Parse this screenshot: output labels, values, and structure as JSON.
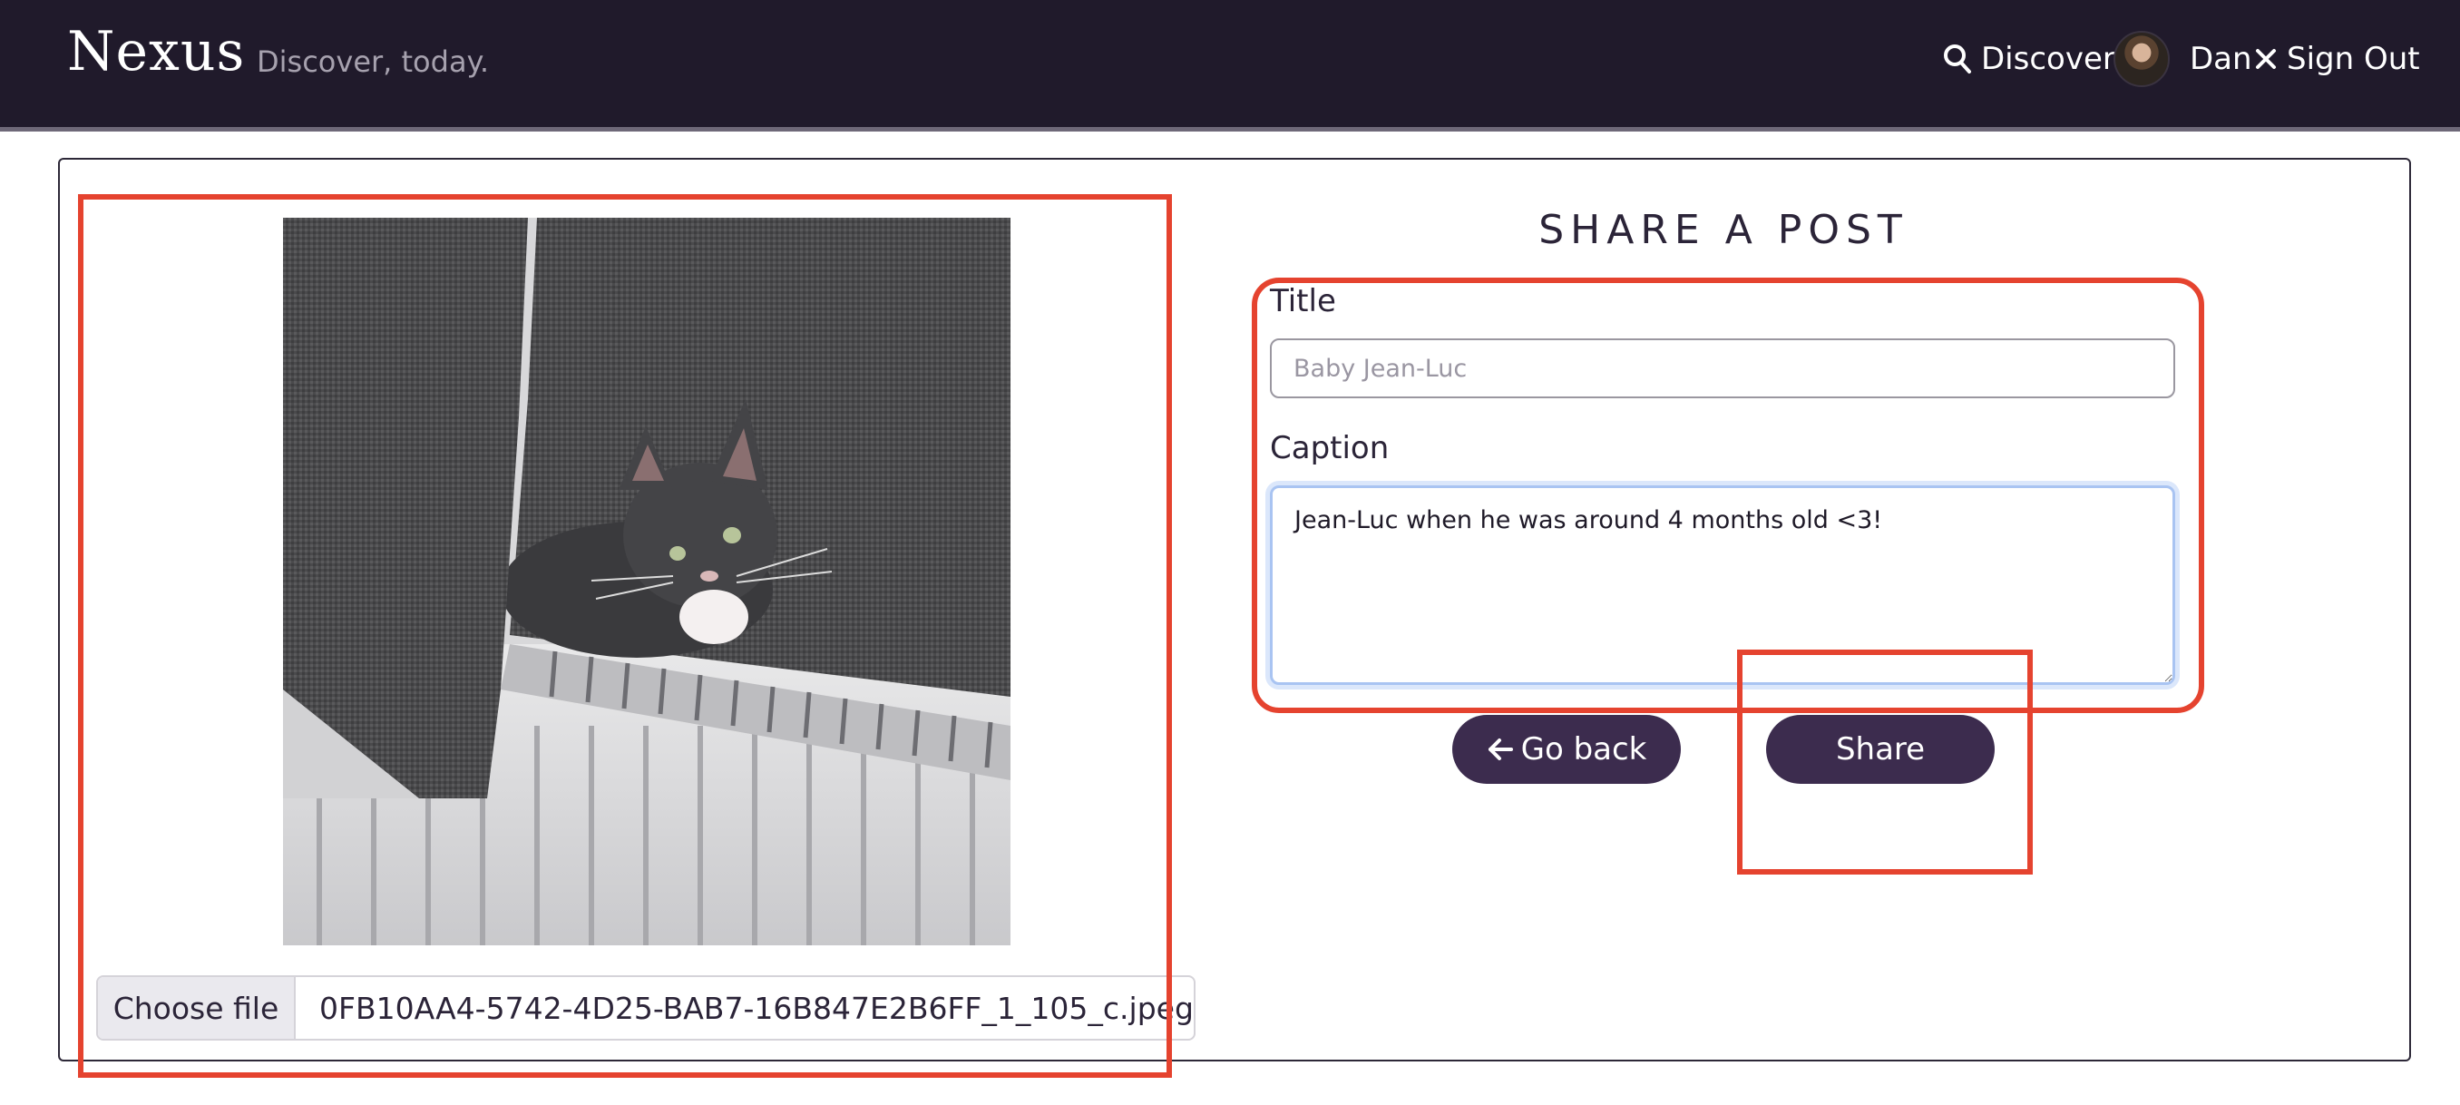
{
  "header": {
    "brand": "Nexus",
    "tagline": "Discover, today.",
    "nav": {
      "discover": "Discover",
      "user_name": "Dan",
      "sign_out": "Sign Out"
    }
  },
  "upload": {
    "choose_file_label": "Choose file",
    "file_name": "0FB10AA4-5742-4D25-BAB7-16B847E2B6FF_1_105_c.jpeg"
  },
  "form": {
    "heading": "SHARE A POST",
    "title_label": "Title",
    "title_placeholder": "Baby Jean-Luc",
    "caption_label": "Caption",
    "caption_value": "Jean-Luc when he was around 4 months old <3!",
    "go_back_label": "Go back",
    "share_label": "Share"
  },
  "colors": {
    "header_bg": "#201a2b",
    "button_bg": "#3c2c4e",
    "annotation_red": "#e5432f"
  },
  "icons": [
    "search-icon",
    "avatar",
    "close-icon",
    "arrow-left-icon"
  ]
}
